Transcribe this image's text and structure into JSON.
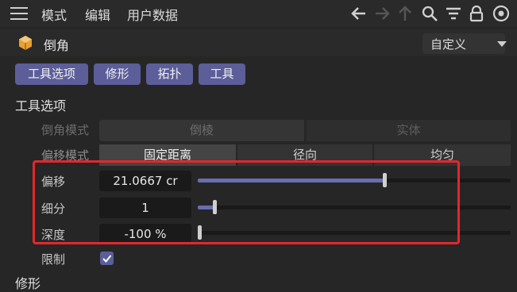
{
  "menubar": {
    "mode": "模式",
    "edit": "编辑",
    "user_data": "用户数据"
  },
  "toolbar_icons": [
    "arrow-left-icon",
    "arrow-right-icon",
    "arrow-up-icon",
    "search-icon",
    "filter-icon",
    "lock-icon",
    "target-icon"
  ],
  "object": {
    "name": "倒角",
    "preset": "自定义"
  },
  "tabs": [
    {
      "label": "工具选项"
    },
    {
      "label": "修形"
    },
    {
      "label": "拓扑"
    },
    {
      "label": "工具"
    }
  ],
  "section": {
    "title": "工具选项",
    "next_title": "修形"
  },
  "bevel_mode": {
    "label": "倒角模式",
    "options": [
      "倒棱",
      "实体"
    ],
    "selected": "倒棱"
  },
  "offset_mode": {
    "label": "偏移模式",
    "options": [
      "固定距离",
      "径向",
      "均匀"
    ],
    "selected": "固定距离"
  },
  "params": {
    "offset": {
      "label": "偏移",
      "value": "21.0667 cr",
      "level": 0.6
    },
    "subdivision": {
      "label": "细分",
      "value": "1",
      "level": 0.05
    },
    "depth": {
      "label": "深度",
      "value": "-100 %",
      "level": 0.0
    }
  },
  "limit": {
    "label": "限制",
    "checked": true
  },
  "colors": {
    "accent": "#5c5e99",
    "slider_fill": "#6a6cb0",
    "highlight": "#e3272d"
  }
}
